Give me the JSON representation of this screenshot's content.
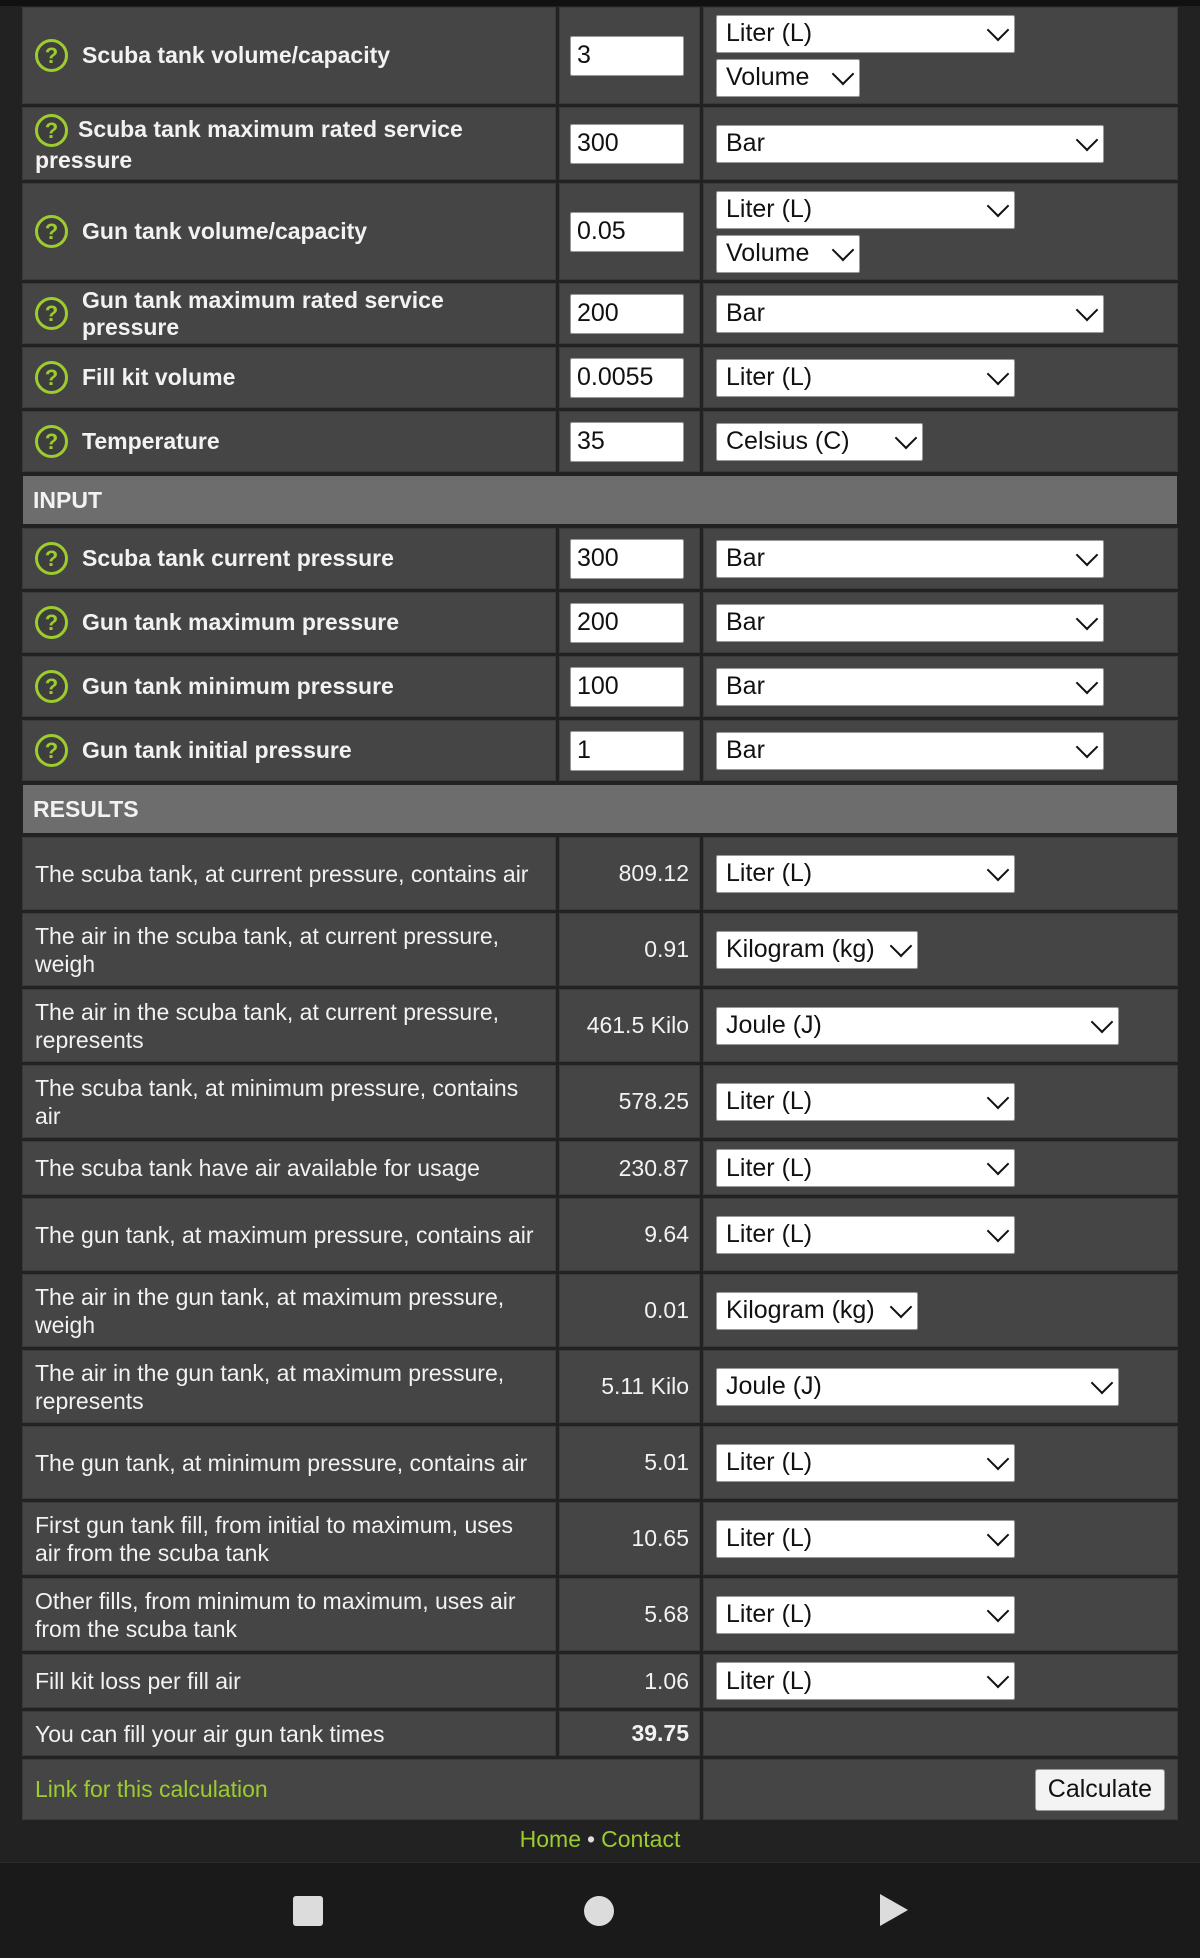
{
  "config": [
    {
      "label": "Scuba tank volume/capacity",
      "value": "3",
      "unit": "Liter (L)",
      "mode": "Volume"
    },
    {
      "label": "Scuba tank maximum rated service pressure",
      "value": "300",
      "unit": "Bar"
    },
    {
      "label": "Gun tank volume/capacity",
      "value": "0.05",
      "unit": "Liter (L)",
      "mode": "Volume"
    },
    {
      "label": "Gun tank maximum rated service pressure",
      "value": "200",
      "unit": "Bar"
    },
    {
      "label": "Fill kit volume",
      "value": "0.0055",
      "unit": "Liter (L)"
    },
    {
      "label": "Temperature",
      "value": "35",
      "unit": "Celsius (C)"
    }
  ],
  "input_section": "INPUT",
  "inputs": [
    {
      "label": "Scuba tank current pressure",
      "value": "300",
      "unit": "Bar"
    },
    {
      "label": "Gun tank maximum pressure",
      "value": "200",
      "unit": "Bar"
    },
    {
      "label": "Gun tank minimum pressure",
      "value": "100",
      "unit": "Bar"
    },
    {
      "label": "Gun tank initial pressure",
      "value": "1",
      "unit": "Bar"
    }
  ],
  "results_section": "RESULTS",
  "results": [
    {
      "label": "The scuba tank, at current pressure, contains air",
      "value": "809.12",
      "unit": "Liter (L)"
    },
    {
      "label": "The air in the scuba tank, at current pressure, weigh",
      "value": "0.91",
      "unit": "Kilogram (kg)"
    },
    {
      "label": "The air in the scuba tank, at current pressure, represents",
      "value": "461.5 Kilo",
      "unit": "Joule (J)"
    },
    {
      "label": "The scuba tank, at minimum pressure, contains air",
      "value": "578.25",
      "unit": "Liter (L)"
    },
    {
      "label": "The scuba tank have air available for usage",
      "value": "230.87",
      "unit": "Liter (L)"
    },
    {
      "label": "The gun tank, at maximum pressure, contains air",
      "value": "9.64",
      "unit": "Liter (L)"
    },
    {
      "label": "The air in the gun tank, at maximum pressure, weigh",
      "value": "0.01",
      "unit": "Kilogram (kg)"
    },
    {
      "label": "The air in the gun tank, at maximum pressure, represents",
      "value": "5.11 Kilo",
      "unit": "Joule (J)"
    },
    {
      "label": "The gun tank, at minimum pressure, contains air",
      "value": "5.01",
      "unit": "Liter (L)"
    },
    {
      "label": "First gun tank fill, from initial to maximum, uses air from the scuba tank",
      "value": "10.65",
      "unit": "Liter (L)"
    },
    {
      "label": "Other fills, from minimum to maximum, uses air from the scuba tank",
      "value": "5.68",
      "unit": "Liter (L)"
    },
    {
      "label": "Fill kit loss per fill air",
      "value": "1.06",
      "unit": "Liter (L)"
    }
  ],
  "final": {
    "label": "You can fill your air gun tank times",
    "value": "39.75"
  },
  "actions": {
    "link": "Link for this calculation",
    "calculate": "Calculate"
  },
  "footer": {
    "home": "Home",
    "sep": "•",
    "contact": "Contact"
  },
  "help_glyph": "?",
  "colors": {
    "accent": "#9ccc2e",
    "cell_bg": "#454545",
    "section_bg": "#6d6d6d",
    "page_bg": "#222222"
  },
  "icons": [
    "help-icon",
    "chevron-down-icon",
    "nav-recents-icon",
    "nav-home-icon",
    "nav-back-icon"
  ]
}
